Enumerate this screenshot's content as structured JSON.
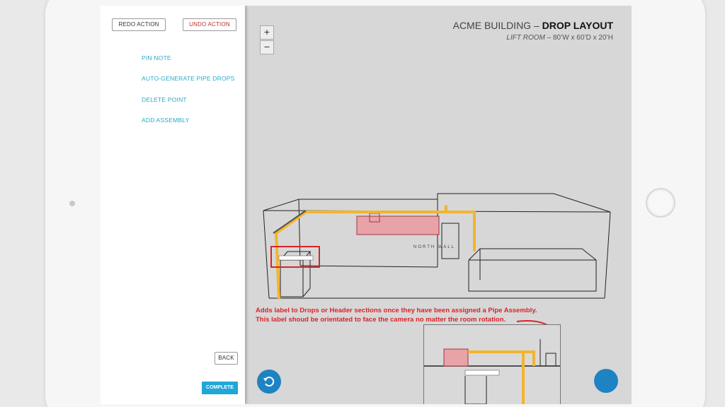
{
  "app": {
    "title_prefix": "ACME BUILDING –",
    "title_bold": "DROP LAYOUT",
    "subtitle_room": "LIFT ROOM",
    "subtitle_dims": "– 80’W x 60’D x 20’H"
  },
  "toolbar": {
    "redo_label": "REDO ACTION",
    "undo_label": "UNDO ACTION"
  },
  "menu": {
    "items": [
      {
        "label": "PIN NOTE"
      },
      {
        "label": "AUTO-GENERATE PIPE DROPS"
      },
      {
        "label": "DELETE POINT"
      },
      {
        "label": "ADD ASSEMBLY"
      }
    ]
  },
  "footer": {
    "back_label": "BACK",
    "complete_label": "COMPLETE"
  },
  "zoom": {
    "in_label": "+",
    "out_label": "−"
  },
  "annotation": {
    "line1": "Adds label to Drops or Header sections once they have been assigned a Pipe Assembly.",
    "line2": "This label shoud be orientated to face the camera no matter the room rotation."
  },
  "scene": {
    "wall_label": "North Wall",
    "pipe_color": "#f2b52c",
    "highlight_color": "#d8242a",
    "header_box_color": "#e7a3a8"
  },
  "icons": {
    "rotate": "rotate-icon"
  }
}
